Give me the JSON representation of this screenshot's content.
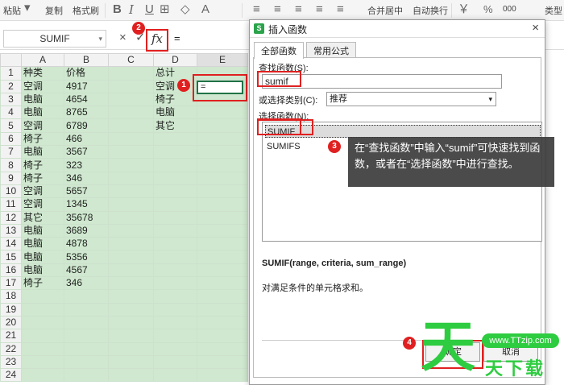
{
  "toolbar": {
    "paste": "粘贴",
    "copy": "复制",
    "format_painter": "格式刷",
    "bold": "B",
    "merge_center": "合并居中",
    "wrap_text": "自动换行",
    "currency": "￥",
    "percent": "%",
    "thousands": "000",
    "type_convert": "类型"
  },
  "formula_bar": {
    "name_box": "SUMIF",
    "cancel": "×",
    "confirm": "✓",
    "fx": "fx",
    "value": "="
  },
  "columns": [
    "A",
    "B",
    "C",
    "D",
    "E"
  ],
  "rows": [
    {
      "n": "1",
      "a": "种类",
      "b": "价格",
      "d": "总计"
    },
    {
      "n": "2",
      "a": "空调",
      "b": "4917",
      "d": "空调"
    },
    {
      "n": "3",
      "a": "电脑",
      "b": "4654",
      "d": "椅子"
    },
    {
      "n": "4",
      "a": "电脑",
      "b": "8765",
      "d": "电脑"
    },
    {
      "n": "5",
      "a": "空调",
      "b": "6789",
      "d": "其它"
    },
    {
      "n": "6",
      "a": "椅子",
      "b": "466",
      "d": ""
    },
    {
      "n": "7",
      "a": "电脑",
      "b": "3567",
      "d": ""
    },
    {
      "n": "8",
      "a": "椅子",
      "b": "323",
      "d": ""
    },
    {
      "n": "9",
      "a": "椅子",
      "b": "346",
      "d": ""
    },
    {
      "n": "10",
      "a": "空调",
      "b": "5657",
      "d": ""
    },
    {
      "n": "11",
      "a": "空调",
      "b": "1345",
      "d": ""
    },
    {
      "n": "12",
      "a": "其它",
      "b": "35678",
      "d": ""
    },
    {
      "n": "13",
      "a": "电脑",
      "b": "3689",
      "d": ""
    },
    {
      "n": "14",
      "a": "电脑",
      "b": "4878",
      "d": ""
    },
    {
      "n": "15",
      "a": "电脑",
      "b": "5356",
      "d": ""
    },
    {
      "n": "16",
      "a": "电脑",
      "b": "4567",
      "d": ""
    },
    {
      "n": "17",
      "a": "椅子",
      "b": "346",
      "d": ""
    },
    {
      "n": "18",
      "a": "",
      "b": "",
      "d": ""
    },
    {
      "n": "19",
      "a": "",
      "b": "",
      "d": ""
    },
    {
      "n": "20",
      "a": "",
      "b": "",
      "d": ""
    },
    {
      "n": "21",
      "a": "",
      "b": "",
      "d": ""
    },
    {
      "n": "22",
      "a": "",
      "b": "",
      "d": ""
    },
    {
      "n": "23",
      "a": "",
      "b": "",
      "d": ""
    },
    {
      "n": "24",
      "a": "",
      "b": "",
      "d": ""
    }
  ],
  "active_cell_value": "=",
  "dialog": {
    "title": "插入函数",
    "close": "×",
    "tab_all": "全部函数",
    "tab_common": "常用公式",
    "search_label": "查找函数(S):",
    "search_value": "sumif",
    "category_label": "或选择类别(C):",
    "category_value": "推荐",
    "select_label": "选择函数(N):",
    "functions": [
      "SUMIF",
      "SUMIFS"
    ],
    "signature": "SUMIF(range, criteria, sum_range)",
    "description": "对满足条件的单元格求和。",
    "ok": "确定",
    "cancel": "取消"
  },
  "badges": [
    "1",
    "2",
    "3",
    "4"
  ],
  "tooltip": "在“查找函数”中输入“sumif”可快速找到函数，或者在“选择函数”中进行查找。",
  "watermark": {
    "char": "天",
    "url": "www.TTzip.com",
    "text": "天下载"
  },
  "colors": {
    "cell_bg": "#cfe8cf",
    "annotation_red": "#e02020",
    "watermark_green": "#2ecc40",
    "selection_green": "#217346"
  }
}
